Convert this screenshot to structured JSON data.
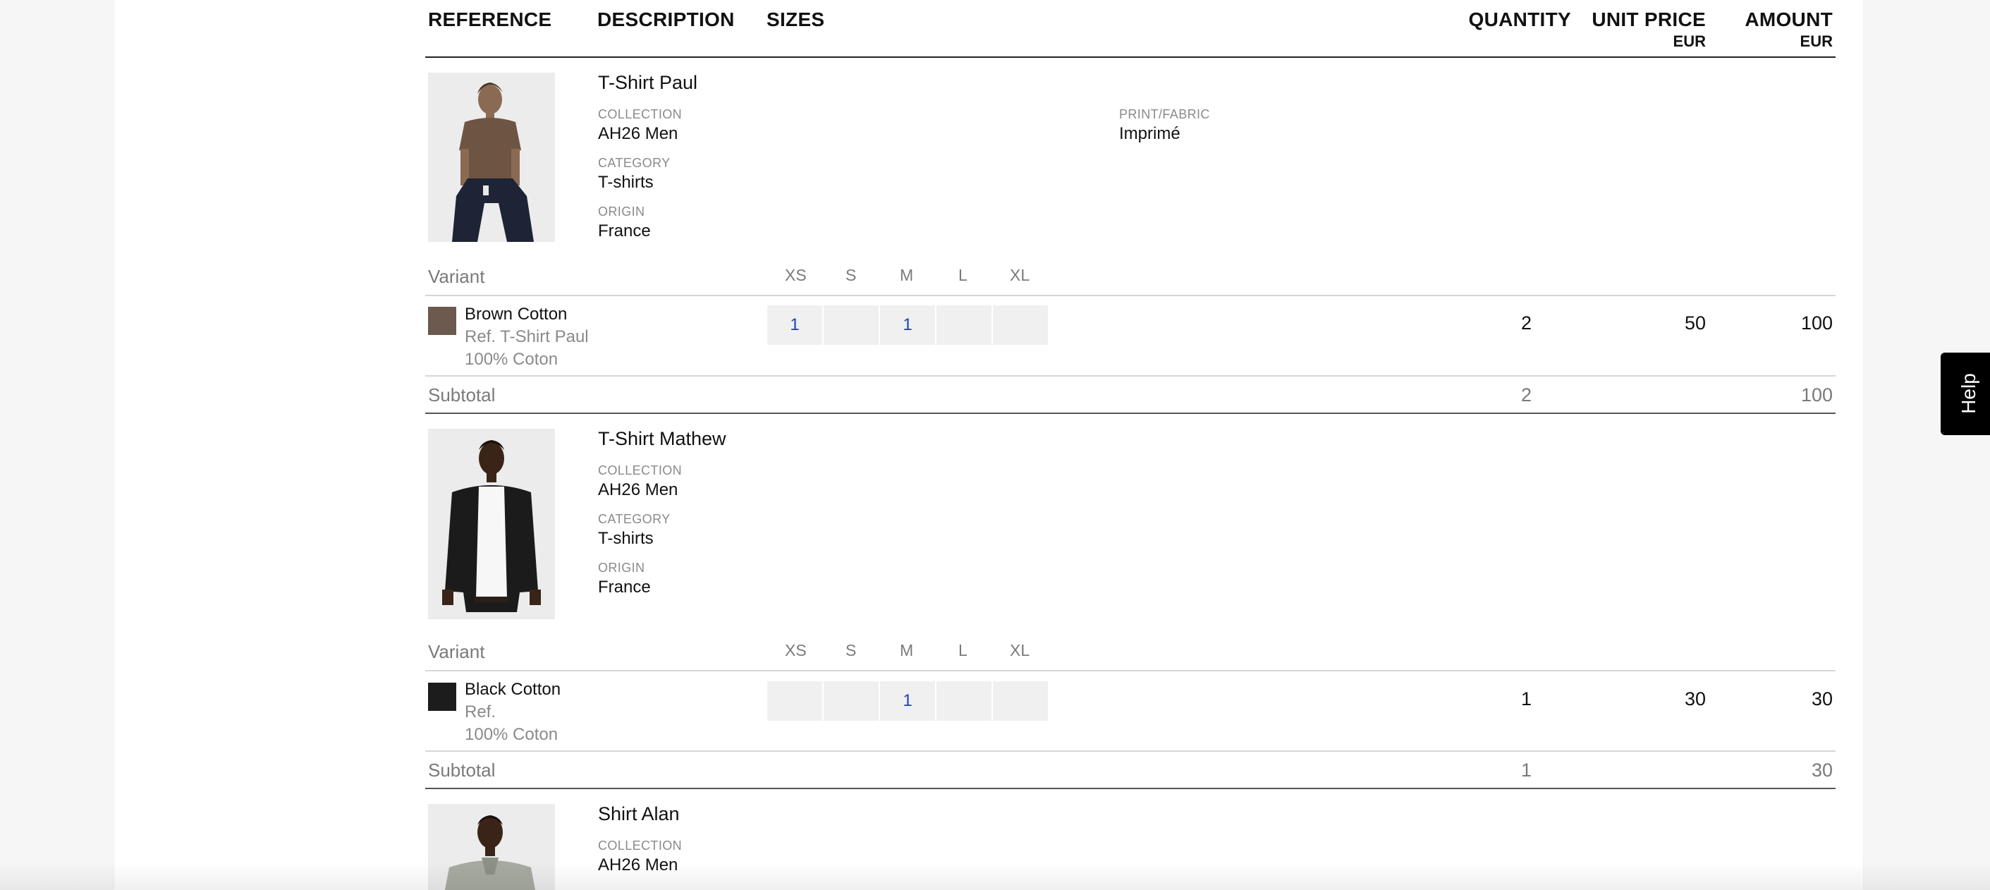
{
  "table_header": {
    "reference": "REFERENCE",
    "description": "DESCRIPTION",
    "sizes": "SIZES",
    "quantity": "QUANTITY",
    "unit_price": "UNIT PRICE",
    "unit_price_currency": "EUR",
    "amount": "AMOUNT",
    "amount_currency": "EUR"
  },
  "labels": {
    "variant": "Variant",
    "subtotal": "Subtotal",
    "collection": "COLLECTION",
    "category": "CATEGORY",
    "origin": "ORIGIN",
    "print_fabric": "PRINT/FABRIC"
  },
  "sizes": [
    "XS",
    "S",
    "M",
    "L",
    "XL"
  ],
  "products": [
    {
      "title": "T-Shirt Paul",
      "collection": "AH26 Men",
      "category": "T-shirts",
      "origin": "France",
      "print_fabric": "Imprimé",
      "image": "man-in-brown-t-shirt-photo",
      "variant": {
        "name": "Brown Cotton",
        "ref": "Ref. T-Shirt Paul",
        "composition": "100% Coton",
        "swatch_color": "#6b5a4d",
        "size_quantities": [
          "1",
          "",
          "1",
          "",
          ""
        ],
        "quantity": "2",
        "unit_price": "50",
        "amount": "100"
      },
      "subtotal_quantity": "2",
      "subtotal_amount": "100"
    },
    {
      "title": "T-Shirt Mathew",
      "collection": "AH26 Men",
      "category": "T-shirts",
      "origin": "France",
      "image": "man-in-black-overshirt-photo",
      "variant": {
        "name": "Black Cotton",
        "ref": "Ref.",
        "composition": "100% Coton",
        "swatch_color": "#1c1c1c",
        "size_quantities": [
          "",
          "",
          "1",
          "",
          ""
        ],
        "quantity": "1",
        "unit_price": "30",
        "amount": "30"
      },
      "subtotal_quantity": "1",
      "subtotal_amount": "30"
    },
    {
      "title": "Shirt Alan",
      "collection": "AH26 Men",
      "image": "man-in-grey-shirt-photo"
    }
  ],
  "help_button": "Help",
  "colors": {
    "size_cell_bg": "#f0f0f0",
    "size_qty_text": "#1f3fbf",
    "help_bg": "#000000"
  }
}
